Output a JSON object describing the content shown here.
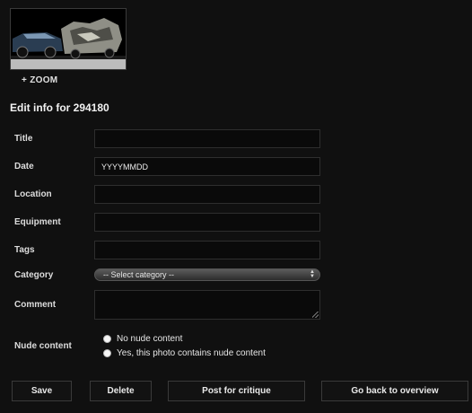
{
  "photo": {
    "zoom_label": "+ ZOOM"
  },
  "page_title": "Edit info for 294180",
  "form": {
    "title_label": "Title",
    "title_value": "",
    "date_label": "Date",
    "date_value": "YYYYMMDD",
    "location_label": "Location",
    "location_value": "",
    "equipment_label": "Equipment",
    "equipment_value": "",
    "tags_label": "Tags",
    "tags_value": "",
    "category_label": "Category",
    "category_selected": "-- Select category --",
    "comment_label": "Comment",
    "nude_label": "Nude content",
    "nude_options": [
      "No nude content",
      "Yes, this photo contains nude content"
    ]
  },
  "buttons": {
    "save": "Save",
    "delete": "Delete",
    "post_critique": "Post for critique",
    "back_overview": "Go back to overview"
  }
}
